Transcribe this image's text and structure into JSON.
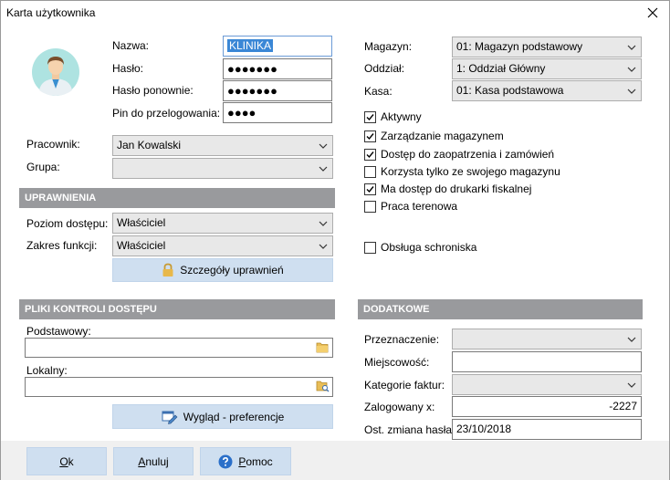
{
  "window": {
    "title": "Karta użytkownika"
  },
  "user": {
    "name_label": "Nazwa:",
    "name_value": "KLINIKA",
    "password_label": "Hasło:",
    "password_value": "●●●●●●●",
    "password2_label": "Hasło ponownie:",
    "password2_value": "●●●●●●●",
    "pin_label": "Pin do przelogowania:",
    "pin_value": "●●●●"
  },
  "employee": {
    "label": "Pracownik:",
    "value": "Jan Kowalski",
    "group_label": "Grupa:",
    "group_value": ""
  },
  "permissions": {
    "header": "UPRAWNIENIA",
    "access_label": "Poziom dostępu:",
    "access_value": "Właściciel",
    "scope_label": "Zakres funkcji:",
    "scope_value": "Właściciel",
    "details_button": "Szczegóły uprawnień"
  },
  "access_files": {
    "header": "PLIKI KONTROLI DOSTĘPU",
    "basic_label": "Podstawowy:",
    "basic_value": "",
    "local_label": "Lokalny:",
    "local_value": "",
    "appearance_button": "Wygląd - preferencje"
  },
  "location": {
    "warehouse_label": "Magazyn:",
    "warehouse_value": "01: Magazyn podstawowy",
    "branch_label": "Oddział:",
    "branch_value": "1: Oddział Główny",
    "cash_label": "Kasa:",
    "cash_value": "01: Kasa podstawowa"
  },
  "options": [
    {
      "label": "Aktywny",
      "checked": true
    },
    {
      "label": "Zarządzanie magazynem",
      "checked": true
    },
    {
      "label": "Dostęp do zaopatrzenia i zamówień",
      "checked": true
    },
    {
      "label": "Korzysta tylko ze swojego magazynu",
      "checked": false
    },
    {
      "label": "Ma dostęp do drukarki fiskalnej",
      "checked": true
    },
    {
      "label": "Praca terenowa",
      "checked": false
    },
    {
      "label": "Obsługa schroniska",
      "checked": false
    }
  ],
  "additional": {
    "header": "DODATKOWE",
    "purpose_label": "Przeznaczenie:",
    "purpose_value": "",
    "city_label": "Miejscowość:",
    "city_value": "",
    "invoice_cat_label": "Kategorie faktur:",
    "invoice_cat_value": "",
    "logged_label": "Zalogowany x:",
    "logged_value": "-2227",
    "pwd_change_label": "Ost. zmiana hasła:",
    "pwd_change_value": "23/10/2018"
  },
  "buttons": {
    "ok": "Ok",
    "cancel": "Anuluj",
    "help": "Pomoc"
  },
  "colors": {
    "header": "#999a9d",
    "button": "#cfdff0",
    "selection": "#3a87d6"
  }
}
